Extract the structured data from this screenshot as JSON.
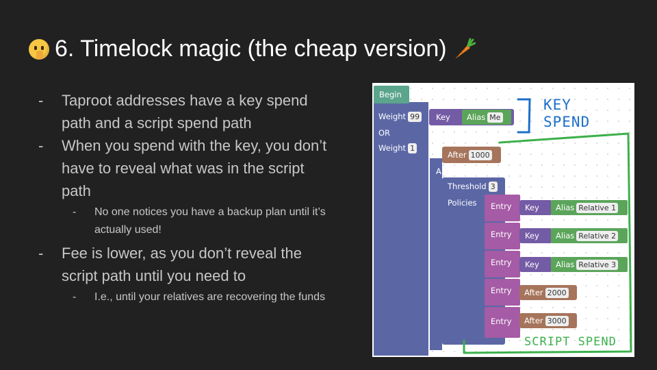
{
  "title": {
    "text": "6. Timelock magic (the cheap version)",
    "lead_icon": "shushing-face-emoji",
    "trail_icon": "carrot-emoji"
  },
  "bullets": [
    {
      "text": "Taproot addresses have a key spend path and a script spend path"
    },
    {
      "text": "When you spend with the key, you don’t have to reveal what was in the script path"
    },
    {
      "sub": "No one notices you have a backup plan until it’s actually used!"
    },
    {
      "text": "Fee is lower, as you don’t reveal the script path until you need to"
    },
    {
      "sub": "I.e., until your relatives are recovering the funds"
    }
  ],
  "blocks": {
    "begin": "Begin",
    "weight_label": "Weight",
    "weight_key_value": "99",
    "or_label": "OR",
    "weight_script_value": "1",
    "key_label": "Key",
    "alias_label": "Alias",
    "alias_me": "Me",
    "after_label": "After",
    "after_1000": "1000",
    "and_label": "AND",
    "threshold_label": "Threshold",
    "threshold_value": "3",
    "policies_label": "Policies",
    "entry_label": "Entry",
    "relative_1": "Relative 1",
    "relative_2": "Relative 2",
    "relative_3": "Relative 3",
    "after_2000": "2000",
    "after_3000": "3000"
  },
  "annotations": {
    "key_spend_line1": "KEY",
    "key_spend_line2": "SPEND",
    "script_spend": "SCRIPT SPEND"
  },
  "colors": {
    "background": "#212121",
    "begin_block": "#5ba58c",
    "or_block": "#5b67a5",
    "key_block": "#745ba5",
    "alias_block": "#5ba55b",
    "after_block": "#a5745b",
    "entry_block": "#a55ba5",
    "annotation_blue": "#1c6fc9",
    "annotation_green": "#3cb04c"
  }
}
